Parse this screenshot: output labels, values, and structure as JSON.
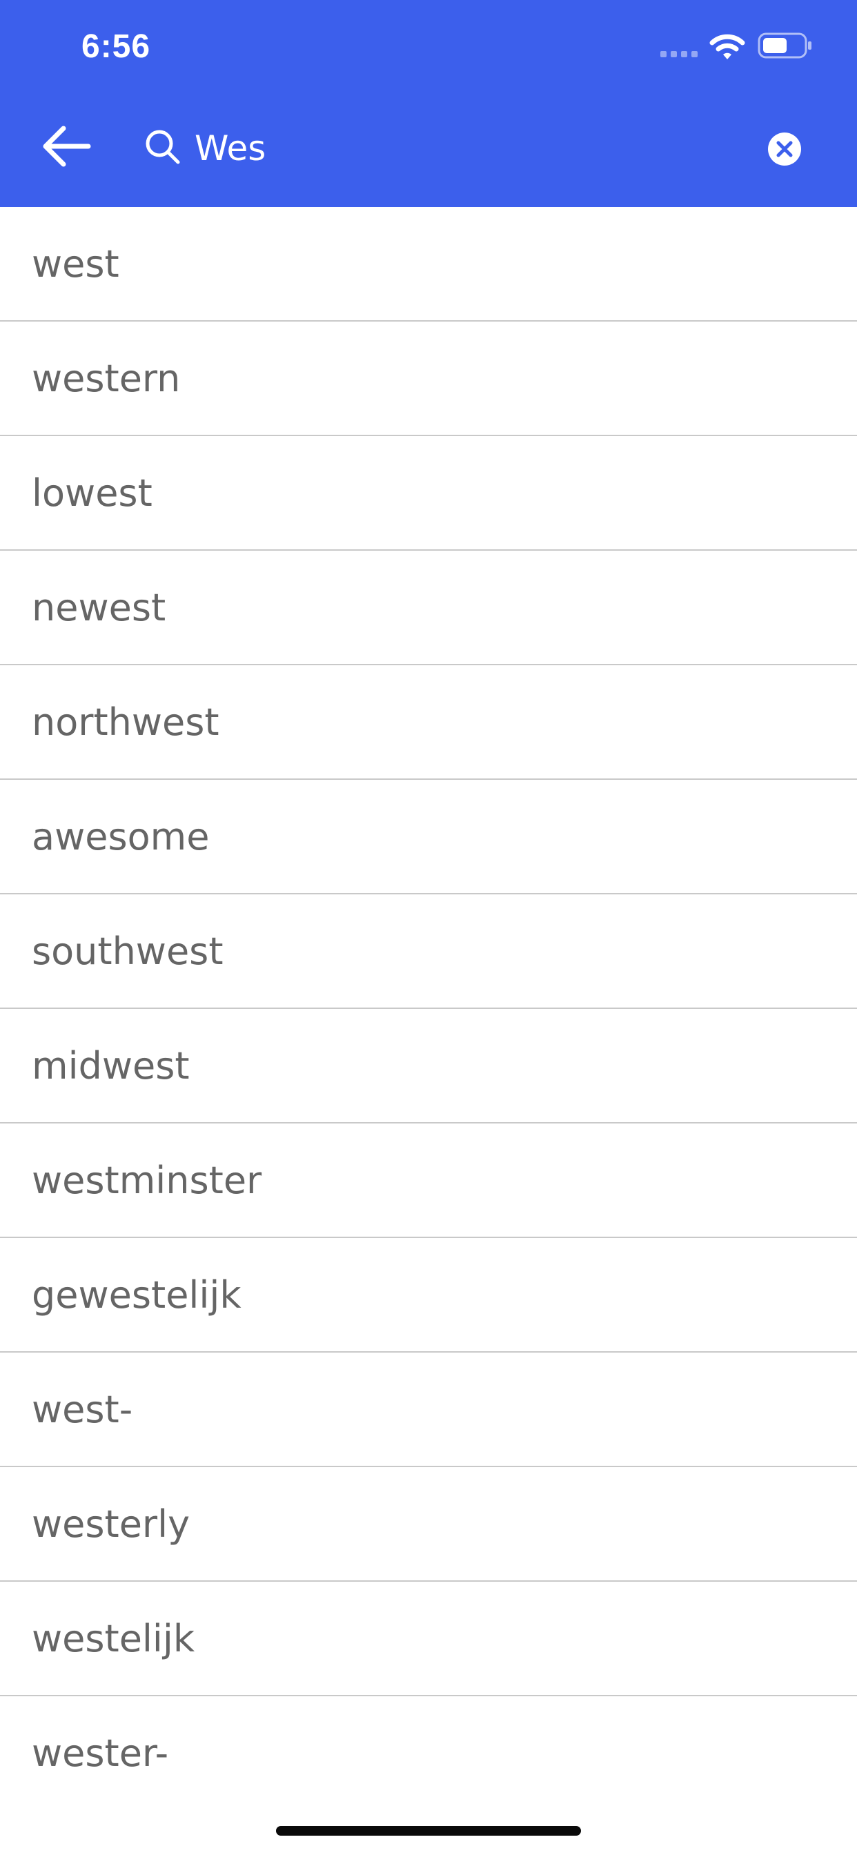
{
  "status_bar": {
    "time": "6:56"
  },
  "header": {
    "background_color": "#3c5fec",
    "back_icon": "arrow-left-icon",
    "search_icon": "search-icon",
    "clear_icon": "close-circle-icon"
  },
  "search": {
    "value": "Wes"
  },
  "results": [
    "west",
    "western",
    "lowest",
    "newest",
    "northwest",
    "awesome",
    "southwest",
    "midwest",
    "westminster",
    "gewestelijk",
    "west-",
    "westerly",
    "westelijk",
    "wester-"
  ]
}
